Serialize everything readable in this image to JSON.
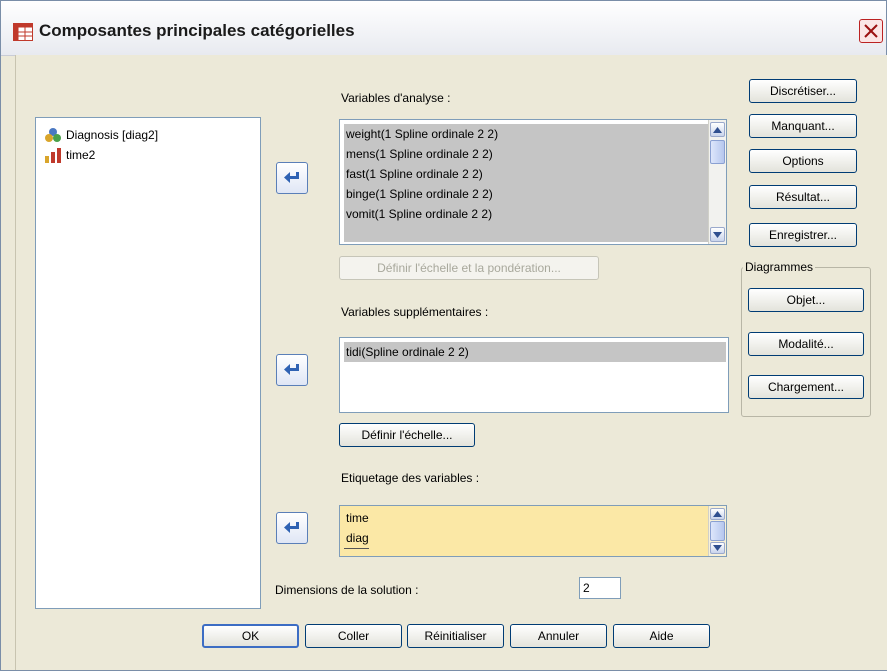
{
  "window": {
    "title": "Composantes principales catégorielles"
  },
  "source_list": {
    "items": [
      {
        "label": "Diagnosis [diag2]",
        "icon": "nominal-variable-icon"
      },
      {
        "label": "time2",
        "icon": "scale-variable-icon"
      }
    ]
  },
  "analysis": {
    "label": "Variables d'analyse :",
    "items": [
      "weight(1 Spline ordinale 2 2)",
      "mens(1 Spline ordinale 2 2)",
      "fast(1 Spline ordinale 2 2)",
      "binge(1 Spline ordinale 2 2)",
      "vomit(1 Spline ordinale 2 2)"
    ],
    "define_button": "Définir l'échelle et la pondération..."
  },
  "supplementary": {
    "label": "Variables supplémentaires :",
    "items": [
      "tidi(Spline ordinale 2 2)"
    ],
    "define_button": "Définir l'échelle..."
  },
  "labeling": {
    "label": "Etiquetage des variables :",
    "items": [
      "time",
      "diag"
    ]
  },
  "dimensions": {
    "label": "Dimensions de la solution :",
    "value": "2"
  },
  "right_buttons": {
    "discretize": "Discrétiser...",
    "missing": "Manquant...",
    "options": "Options",
    "output": "Résultat...",
    "save": "Enregistrer..."
  },
  "plots": {
    "legend": "Diagrammes",
    "object": "Objet...",
    "category": "Modalité...",
    "loading": "Chargement..."
  },
  "footer": {
    "ok": "OK",
    "paste": "Coller",
    "reset": "Réinitialiser",
    "cancel": "Annuler",
    "help": "Aide"
  },
  "colors": {
    "dialog_bg": "#ece9d8",
    "selection_gray": "#c5c5c5",
    "highlight_yellow": "#fbe8a6",
    "arrow_blue": "#2f62b3"
  }
}
